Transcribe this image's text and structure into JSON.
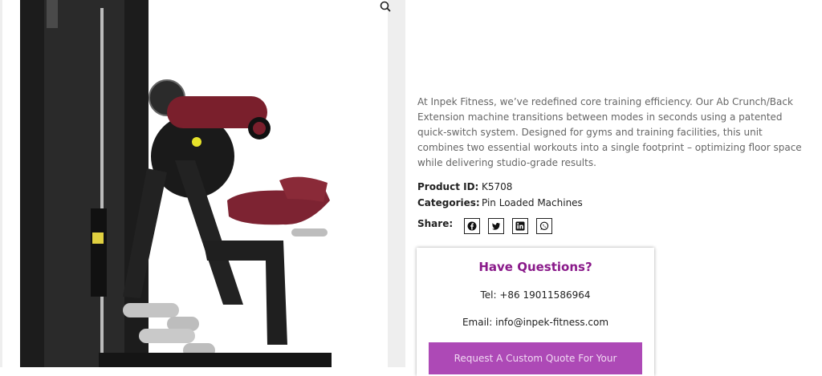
{
  "product": {
    "image_alt": "Ab Crunch/Back Extension machine",
    "description": "At Inpek Fitness, we’ve redefined core training efficiency. Our Ab Crunch/Back Extension machine transitions between modes in seconds using a patented quick-switch system. Designed for gyms and training facilities, this unit combines two essential workouts into a single footprint – optimizing floor space while delivering studio-grade results.",
    "meta": {
      "id_label": "Product ID:",
      "id_value": "K5708",
      "categories_label": "Categories:",
      "categories_value": "Pin Loaded Machines"
    }
  },
  "share": {
    "label": "Share:",
    "icons": [
      "facebook-icon",
      "twitter-icon",
      "linkedin-icon",
      "whatsapp-icon"
    ]
  },
  "questions": {
    "title": "Have Questions?",
    "tel": "Tel: +86 19011586964",
    "email": "Email: info@inpek-fitness.com",
    "button": "Request A Custom Quote For Your"
  },
  "colors": {
    "accent_purple": "#8a1a8a",
    "button_bg": "#ad49b6",
    "pad_maroon": "#7a1f2c"
  }
}
